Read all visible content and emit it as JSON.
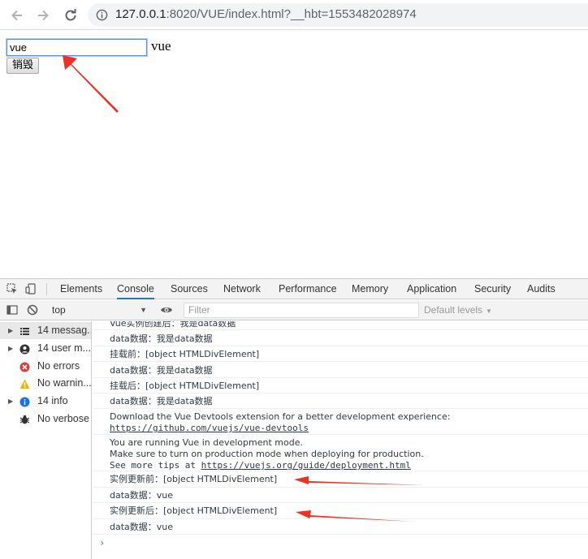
{
  "browser": {
    "url_host": "127.0.0.1",
    "url_rest": ":8020/VUE/index.html?__hbt=1553482028974"
  },
  "page": {
    "input_value": "vue",
    "text": "vue",
    "destroy_button_label": "销毁"
  },
  "devtools": {
    "tabs": [
      "Elements",
      "Console",
      "Sources",
      "Network",
      "Performance",
      "Memory",
      "Application",
      "Security",
      "Audits"
    ],
    "active_tab": "Console",
    "context": "top",
    "filter_placeholder": "Filter",
    "levels_label": "Default levels",
    "sidebar": [
      {
        "label": "14 messag...",
        "icon": "list-icon",
        "expandable": true,
        "selected": true
      },
      {
        "label": "14 user m...",
        "icon": "user-icon",
        "expandable": true,
        "selected": false
      },
      {
        "label": "No errors",
        "icon": "error-icon",
        "expandable": false,
        "selected": false
      },
      {
        "label": "No warnin...",
        "icon": "warning-icon",
        "expandable": false,
        "selected": false
      },
      {
        "label": "14 info",
        "icon": "info-icon",
        "expandable": true,
        "selected": false
      },
      {
        "label": "No verbose",
        "icon": "verbose-icon",
        "expandable": false,
        "selected": false
      }
    ],
    "messages": [
      {
        "lines": [
          "Vue实例创建后：我是data数据"
        ]
      },
      {
        "lines": [
          "data数据：我是data数据"
        ]
      },
      {
        "lines": [
          "挂载前：[object HTMLDivElement]"
        ]
      },
      {
        "lines": [
          "data数据：我是data数据"
        ]
      },
      {
        "lines": [
          "挂载后：[object HTMLDivElement]"
        ]
      },
      {
        "lines": [
          "data数据：我是data数据"
        ]
      },
      {
        "lines": [
          "Download the Vue Devtools extension for a better development experience:"
        ],
        "link": "https://github.com/vuejs/vue-devtools"
      },
      {
        "lines": [
          "You are running Vue in development mode.",
          "Make sure to turn on production mode when deploying for production."
        ],
        "prefix": "See more tips at ",
        "link": "https://vuejs.org/guide/deployment.html"
      },
      {
        "lines": [
          "实例更新前：[object HTMLDivElement]"
        ]
      },
      {
        "lines": [
          "data数据：vue"
        ]
      },
      {
        "lines": [
          "实例更新后：[object HTMLDivElement]"
        ]
      },
      {
        "lines": [
          "data数据：vue"
        ]
      }
    ],
    "prompt": "›"
  },
  "colors": {
    "arrow": "#ea3323",
    "active_tab_underline": "#1a73e8",
    "error": "#e53935",
    "warning": "#f4b400",
    "info": "#1a73e8"
  }
}
